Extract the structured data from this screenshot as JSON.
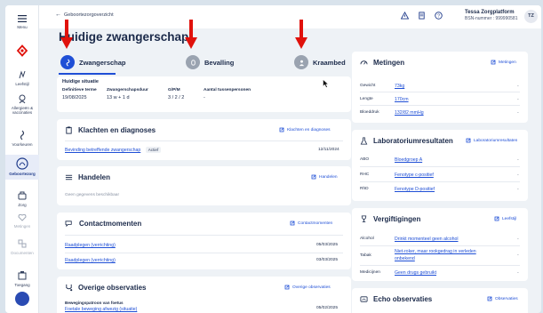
{
  "header": {
    "back_label": "Geboortezorgoverzicht",
    "user_name": "Tessa Zorgplatform",
    "user_bsn": "BSN-nummer : 999990581",
    "user_initials": "TZ"
  },
  "rail": {
    "items": [
      {
        "label": "Menu",
        "icon": "menu-icon"
      },
      {
        "label": "",
        "icon": "app-logo-icon"
      },
      {
        "label": "Leefstijl",
        "icon": "lifestyle-icon"
      },
      {
        "label": "Allergieën & vaccinaties",
        "icon": "allergy-icon"
      },
      {
        "label": "Voorkeuren",
        "icon": "preferences-icon"
      },
      {
        "label": "Geboortezorg",
        "icon": "birth-care-icon"
      },
      {
        "label": "Zorg",
        "icon": "care-icon"
      },
      {
        "label": "Metingen",
        "icon": "measurements-icon"
      },
      {
        "label": "Documenten",
        "icon": "documents-icon"
      },
      {
        "label": "Toegang",
        "icon": "access-icon"
      }
    ]
  },
  "page": {
    "title": "Huidige zwangerschap"
  },
  "tabs": [
    {
      "label": "Zwangerschap",
      "active": true
    },
    {
      "label": "Bevalling",
      "active": false
    },
    {
      "label": "Kraambed",
      "active": false
    }
  ],
  "situatie": {
    "title": "Huidige situatie",
    "headers": [
      "Definitieve terme",
      "Zwangerschapsduur",
      "G/P/M",
      "Aantal tussenpersonen"
    ],
    "values": [
      "19/08/2025",
      "13 w + 1 d",
      "3 / 2 / 2",
      "-"
    ]
  },
  "klachten": {
    "title": "Klachten en diagnoses",
    "link": "Klachten en diagnoses",
    "row_label": "Bevinding betreffende zwangerschap",
    "row_status": "Actief",
    "row_date": "12/11/2024"
  },
  "handelen": {
    "title": "Handelen",
    "link": "Handelen",
    "empty": "Geen gegevens beschikbaar"
  },
  "contact": {
    "title": "Contactmomenten",
    "link": "Contactmomenten",
    "rows": [
      {
        "label": "Raadplegen (verrichting)",
        "date": "05/03/2025"
      },
      {
        "label": "Raadplegen (verrichting)",
        "date": "03/03/2025"
      }
    ]
  },
  "overige": {
    "title": "Overige observaties",
    "link": "Overige observaties",
    "row_header": "Bewegingspatroon van foetus",
    "row_label": "Foetale beweging afwezig (situatie)",
    "row_date": "05/02/2025"
  },
  "metingen": {
    "title": "Metingen",
    "link": "Metingen",
    "rows": [
      {
        "label": "Gewicht",
        "value": "73kg"
      },
      {
        "label": "Lengte",
        "value": "170cm"
      },
      {
        "label": "Bloeddruk",
        "value": "132/82 mmHg"
      }
    ]
  },
  "lab": {
    "title": "Laboratoriumresultaten",
    "link": "Laboratoriumresultaten",
    "rows": [
      {
        "label": "ABO",
        "value": "Bloedgroep A"
      },
      {
        "label": "RHC",
        "value": "Fenotype c-positief"
      },
      {
        "label": "RhD",
        "value": "Fenotype D-positief"
      }
    ]
  },
  "vergiftigingen": {
    "title": "Vergiftigingen",
    "link": "Leefstijl",
    "rows": [
      {
        "label": "Alcohol",
        "value": "Drinkt momenteel geen alcohol"
      },
      {
        "label": "Tabak",
        "value1": "Niet-roker, maar rookgedrag in verleden",
        "value2": "onbekend"
      },
      {
        "label": "Medicijnen",
        "value": "Geen drugs gebruikt"
      }
    ]
  },
  "echo": {
    "title": "Echo observaties",
    "link": "Observaties"
  },
  "colors": {
    "accent": "#1f4fd6",
    "annotation_red": "#e0110b"
  }
}
